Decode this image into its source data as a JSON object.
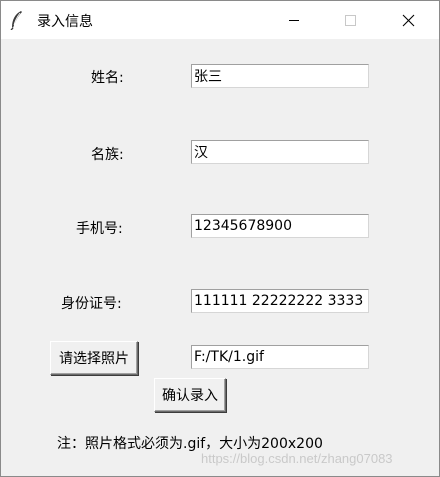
{
  "window": {
    "title": "录入信息",
    "icons": [
      "feather-icon",
      "minimize-icon",
      "maximize-icon",
      "close-icon"
    ]
  },
  "form": {
    "name": {
      "label": "姓名:",
      "value": "张三"
    },
    "ethnicity": {
      "label": "名族:",
      "value": "汉"
    },
    "phone": {
      "label": "手机号:",
      "value": "12345678900"
    },
    "id_number": {
      "label": "身份证号:",
      "value": "111111 22222222 3333"
    },
    "photo": {
      "button_label": "请选择照片",
      "path_value": "F:/TK/1.gif"
    }
  },
  "confirm_button_label": "确认录入",
  "note": "注：照片格式必须为.gif，大小为200x200",
  "watermark": "https://blog.csdn.net/zhang07083",
  "colors": {
    "window_bg": "#f0f0f0",
    "titlebar_bg": "#ffffff",
    "entry_bg": "#ffffff"
  }
}
